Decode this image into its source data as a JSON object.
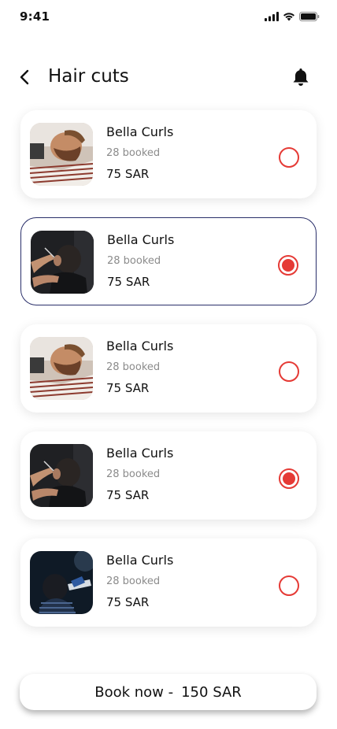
{
  "status_bar": {
    "time": "9:41"
  },
  "header": {
    "title": "Hair cuts"
  },
  "cards": [
    {
      "name": "Bella Curls",
      "booked": "28 booked",
      "price": "75 SAR",
      "selected": false,
      "image": "barber-beard-photo"
    },
    {
      "name": "Bella Curls",
      "booked": "28 booked",
      "price": "75 SAR",
      "selected": true,
      "image": "barber-trim-photo"
    },
    {
      "name": "Bella Curls",
      "booked": "28 booked",
      "price": "75 SAR",
      "selected": false,
      "image": "barber-beard-photo"
    },
    {
      "name": "Bella Curls",
      "booked": "28 booked",
      "price": "75 SAR",
      "selected": true,
      "image": "barber-trim-photo"
    },
    {
      "name": "Bella Curls",
      "booked": "28 booked",
      "price": "75 SAR",
      "selected": false,
      "image": "barber-clipper-photo"
    }
  ],
  "book_button": {
    "label": "Book now -",
    "amount": "150 SAR"
  },
  "colors": {
    "accent": "#e53a35",
    "selected_border": "#2a2f6a"
  }
}
